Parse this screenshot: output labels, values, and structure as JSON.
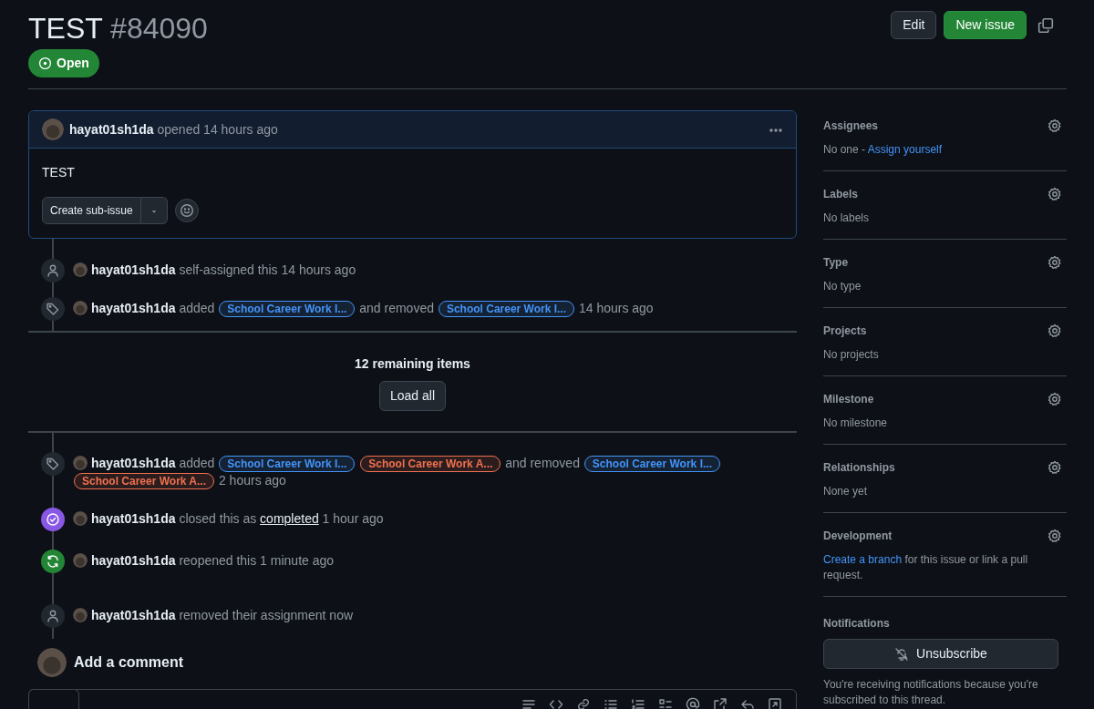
{
  "issue": {
    "title": "TEST",
    "number": "#84090",
    "state": "Open"
  },
  "header_actions": {
    "buttons": [
      {
        "label": "Edit",
        "kind": "default"
      },
      {
        "label": "New issue",
        "kind": "primary"
      }
    ]
  },
  "opening_comment": {
    "author": "hayat01sh1da",
    "action": "opened 14 hours ago",
    "body": "TEST",
    "split_button": "Create sub-issue"
  },
  "timeline_before": [
    {
      "kind": "person",
      "actor": "hayat01sh1da",
      "parts": [
        {
          "kind": "text",
          "text": "self-assigned this 14 hours ago"
        }
      ]
    },
    {
      "kind": "tag",
      "actor": "hayat01sh1da",
      "parts": [
        {
          "kind": "text",
          "text": "added"
        },
        {
          "kind": "label",
          "text": "School Career Work I...",
          "color": "#4493f8"
        },
        {
          "kind": "text",
          "text": "and removed"
        },
        {
          "kind": "label",
          "text": "School Career Work I...",
          "color": "#4493f8"
        },
        {
          "kind": "text",
          "text": "14 hours ago"
        }
      ]
    }
  ],
  "load_more": {
    "count_text": "12 remaining items",
    "button": "Load all"
  },
  "timeline_after": [
    {
      "kind": "tag",
      "actor": "hayat01sh1da",
      "parts": [
        {
          "kind": "text",
          "text": "added"
        },
        {
          "kind": "label",
          "text": "School Career Work I...",
          "color": "#4493f8"
        },
        {
          "kind": "label",
          "text": "School Career Work A...",
          "color": "#f0704f"
        },
        {
          "kind": "text",
          "text": "and removed"
        },
        {
          "kind": "label",
          "text": "School Career Work I...",
          "color": "#4493f8"
        },
        {
          "kind": "label",
          "text": "School Career Work A...",
          "color": "#f0704f"
        },
        {
          "kind": "text",
          "text": "2 hours ago"
        }
      ]
    },
    {
      "kind": "closed",
      "actor": "hayat01sh1da",
      "parts": [
        {
          "kind": "text",
          "text": "closed this as"
        },
        {
          "kind": "link",
          "text": "completed"
        },
        {
          "kind": "text",
          "text": "1 hour ago"
        }
      ]
    },
    {
      "kind": "reopened",
      "actor": "hayat01sh1da",
      "parts": [
        {
          "kind": "text",
          "text": "reopened this 1 minute ago"
        }
      ]
    },
    {
      "kind": "person",
      "actor": "hayat01sh1da",
      "parts": [
        {
          "kind": "text",
          "text": "removed their assignment now"
        }
      ]
    }
  ],
  "add_comment": {
    "heading": "Add a comment",
    "toolbar": [
      {
        "kind": "quote"
      },
      {
        "kind": "code"
      },
      {
        "kind": "link"
      },
      {
        "kind": "ul"
      },
      {
        "kind": "ol"
      },
      {
        "kind": "tasks"
      },
      {
        "kind": "mention"
      },
      {
        "kind": "reference"
      },
      {
        "kind": "undo"
      },
      {
        "kind": "fullscreen"
      }
    ]
  },
  "sidebar": {
    "sections": [
      {
        "title": "Assignees",
        "parts": [
          {
            "kind": "text",
            "text": "No one -"
          },
          {
            "kind": "link",
            "text": "Assign yourself"
          }
        ]
      },
      {
        "title": "Labels",
        "parts": [
          {
            "kind": "text",
            "text": "No labels"
          }
        ]
      },
      {
        "title": "Type",
        "parts": [
          {
            "kind": "text",
            "text": "No type"
          }
        ]
      },
      {
        "title": "Projects",
        "parts": [
          {
            "kind": "text",
            "text": "No projects"
          }
        ]
      },
      {
        "title": "Milestone",
        "parts": [
          {
            "kind": "text",
            "text": "No milestone"
          }
        ]
      },
      {
        "title": "Relationships",
        "parts": [
          {
            "kind": "text",
            "text": "None yet"
          }
        ]
      },
      {
        "title": "Development",
        "parts": [
          {
            "kind": "link",
            "text": "Create a branch"
          },
          {
            "kind": "text",
            "text": "for this issue or link a pull request."
          }
        ]
      }
    ],
    "notifications": {
      "title": "Notifications",
      "button": "Unsubscribe",
      "note": "You're receiving notifications because you're subscribed to this thread."
    }
  }
}
